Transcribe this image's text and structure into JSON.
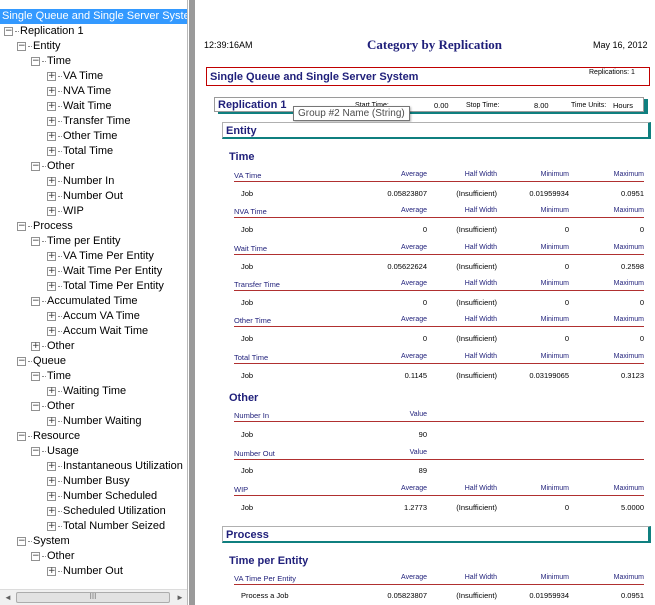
{
  "tree": {
    "root": "Single Queue and Single Server System",
    "nodes": [
      {
        "label": "Replication 1",
        "level": 0,
        "box": "minus"
      },
      {
        "label": "Entity",
        "level": 1,
        "box": "minus"
      },
      {
        "label": "Time",
        "level": 2,
        "box": "minus"
      },
      {
        "label": "VA Time",
        "level": 3,
        "box": "plus"
      },
      {
        "label": "NVA Time",
        "level": 3,
        "box": "plus"
      },
      {
        "label": "Wait Time",
        "level": 3,
        "box": "plus"
      },
      {
        "label": "Transfer Time",
        "level": 3,
        "box": "plus"
      },
      {
        "label": "Other Time",
        "level": 3,
        "box": "plus"
      },
      {
        "label": "Total Time",
        "level": 3,
        "box": "plus"
      },
      {
        "label": "Other",
        "level": 2,
        "box": "minus"
      },
      {
        "label": "Number In",
        "level": 3,
        "box": "plus"
      },
      {
        "label": "Number Out",
        "level": 3,
        "box": "plus"
      },
      {
        "label": "WIP",
        "level": 3,
        "box": "plus"
      },
      {
        "label": "Process",
        "level": 1,
        "box": "minus"
      },
      {
        "label": "Time per Entity",
        "level": 2,
        "box": "minus"
      },
      {
        "label": "VA Time Per Entity",
        "level": 3,
        "box": "plus"
      },
      {
        "label": "Wait Time Per Entity",
        "level": 3,
        "box": "plus"
      },
      {
        "label": "Total Time Per Entity",
        "level": 3,
        "box": "plus"
      },
      {
        "label": "Accumulated Time",
        "level": 2,
        "box": "minus"
      },
      {
        "label": "Accum VA Time",
        "level": 3,
        "box": "plus"
      },
      {
        "label": "Accum Wait Time",
        "level": 3,
        "box": "plus"
      },
      {
        "label": "Other",
        "level": 2,
        "box": "plus"
      },
      {
        "label": "Queue",
        "level": 1,
        "box": "minus"
      },
      {
        "label": "Time",
        "level": 2,
        "box": "minus"
      },
      {
        "label": "Waiting Time",
        "level": 3,
        "box": "plus"
      },
      {
        "label": "Other",
        "level": 2,
        "box": "minus"
      },
      {
        "label": "Number Waiting",
        "level": 3,
        "box": "plus"
      },
      {
        "label": "Resource",
        "level": 1,
        "box": "minus"
      },
      {
        "label": "Usage",
        "level": 2,
        "box": "minus"
      },
      {
        "label": "Instantaneous Utilization",
        "level": 3,
        "box": "plus"
      },
      {
        "label": "Number Busy",
        "level": 3,
        "box": "plus"
      },
      {
        "label": "Number Scheduled",
        "level": 3,
        "box": "plus"
      },
      {
        "label": "Scheduled Utilization",
        "level": 3,
        "box": "plus"
      },
      {
        "label": "Total Number Seized",
        "level": 3,
        "box": "plus"
      },
      {
        "label": "System",
        "level": 1,
        "box": "minus"
      },
      {
        "label": "Other",
        "level": 2,
        "box": "minus"
      },
      {
        "label": "Number Out",
        "level": 3,
        "box": "plus"
      }
    ],
    "scrollbar": {
      "left": "◄",
      "right": "►",
      "grip": "III"
    }
  },
  "report": {
    "time": "12:39:16AM",
    "title": "Category by Replication",
    "date": "May 16, 2012",
    "model": "Single Queue and Single Server System",
    "replications": "Replications:  1",
    "replication": {
      "name": "Replication 1",
      "start_label": "Start Time:",
      "start_value": "0.00",
      "stop_label": "Stop Time:",
      "stop_value": "8.00",
      "units_label": "Time Units:",
      "units_value": "Hours"
    },
    "tooltip": "Group #2 Name (String)",
    "entity_label": "Entity",
    "time_label": "Time",
    "cols": {
      "average": "Average",
      "half": "Half Width",
      "min": "Minimum",
      "max": "Maximum",
      "value": "Value"
    },
    "time_stats": [
      {
        "name": "VA Time",
        "row": "Job",
        "avg": "0.05823807",
        "half": "(Insufficient)",
        "min": "0.01959934",
        "max": "0.0951"
      },
      {
        "name": "NVA Time",
        "row": "Job",
        "avg": "0",
        "half": "(Insufficient)",
        "min": "0",
        "max": "0"
      },
      {
        "name": "Wait Time",
        "row": "Job",
        "avg": "0.05622624",
        "half": "(Insufficient)",
        "min": "0",
        "max": "0.2598"
      },
      {
        "name": "Transfer Time",
        "row": "Job",
        "avg": "0",
        "half": "(Insufficient)",
        "min": "0",
        "max": "0"
      },
      {
        "name": "Other Time",
        "row": "Job",
        "avg": "0",
        "half": "(Insufficient)",
        "min": "0",
        "max": "0"
      },
      {
        "name": "Total Time",
        "row": "Job",
        "avg": "0.1145",
        "half": "(Insufficient)",
        "min": "0.03199065",
        "max": "0.3123"
      }
    ],
    "other_label": "Other",
    "number_in": {
      "name": "Number In",
      "row": "Job",
      "value": "90"
    },
    "number_out": {
      "name": "Number Out",
      "row": "Job",
      "value": "89"
    },
    "wip": {
      "name": "WIP",
      "row": "Job",
      "avg": "1.2773",
      "half": "(Insufficient)",
      "min": "0",
      "max": "5.0000"
    },
    "process_label": "Process",
    "time_per_entity_label": "Time per Entity",
    "va_per_entity": {
      "name": "VA Time Per Entity",
      "row": "Process a Job",
      "avg": "0.05823807",
      "half": "(Insufficient)",
      "min": "0.01959934",
      "max": "0.0951"
    }
  }
}
